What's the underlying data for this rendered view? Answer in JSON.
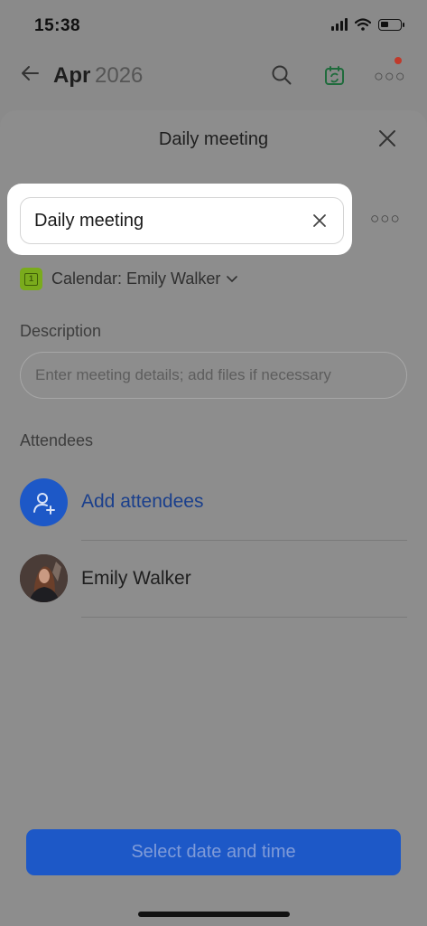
{
  "status_bar": {
    "time": "15:38"
  },
  "calendar_header": {
    "back_icon": "arrow-left-icon",
    "month": "Apr",
    "year": "2026",
    "search_icon": "search-icon",
    "sync_icon": "calendar-sync-icon",
    "more_icon": "more-horizontal-icon",
    "notification_color": "#c03a2b"
  },
  "sheet": {
    "title": "Daily meeting",
    "close_icon": "close-icon",
    "title_input": {
      "value": "Daily meeting",
      "clear_icon": "clear-icon"
    },
    "more_icon": "more-horizontal-icon",
    "calendar": {
      "label": "Calendar: Emily Walker",
      "badge_text": "1",
      "badge_color": "#7aab1c"
    },
    "description": {
      "label": "Description",
      "placeholder": "Enter meeting details; add files if necessary"
    },
    "attendees": {
      "label": "Attendees",
      "add_label": "Add attendees",
      "add_icon": "add-person-icon",
      "list": [
        {
          "name": "Emily Walker"
        }
      ]
    },
    "primary_button": {
      "label": "Select date and time",
      "color": "#1d58c7"
    }
  }
}
